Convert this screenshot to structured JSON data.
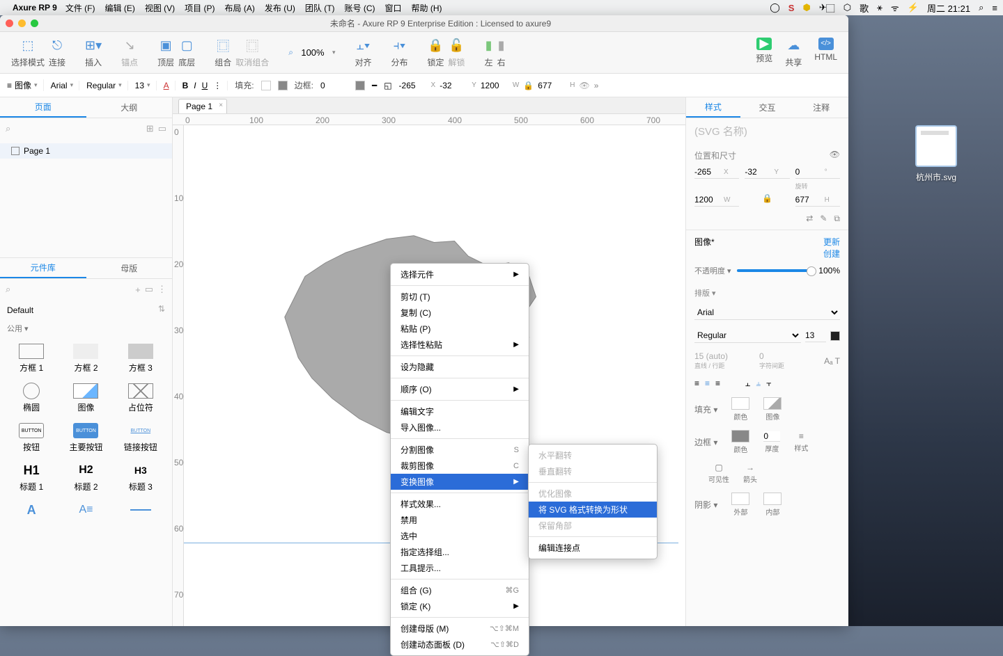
{
  "macmenu": {
    "app": "Axure RP 9",
    "items": [
      "文件 (F)",
      "编辑 (E)",
      "视图 (V)",
      "项目 (P)",
      "布局 (A)",
      "发布 (U)",
      "团队 (T)",
      "账号 (C)",
      "窗口",
      "帮助 (H)"
    ],
    "clock": "周二 21:21"
  },
  "window": {
    "title": "未命名 - Axure RP 9 Enterprise Edition : Licensed to axure9"
  },
  "toolbar": {
    "select_mode": "选择模式",
    "connect": "连接",
    "insert": "插入",
    "point": "锚点",
    "front": "顶层",
    "back": "底层",
    "group": "组合",
    "ungroup": "取消组合",
    "zoom": "100%",
    "align": "对齐",
    "distribute": "分布",
    "lock": "锁定",
    "unlock": "解锁",
    "left": "左",
    "right": "右",
    "preview": "预览",
    "share": "共享",
    "html": "HTML"
  },
  "style_toolbar": {
    "shape": "图像",
    "font": "Arial",
    "weight": "Regular",
    "size": "13",
    "fill": "填充:",
    "border": "边框:",
    "border_w": "0",
    "x": "-265",
    "y": "-32",
    "w": "1200",
    "h": "677"
  },
  "left": {
    "tab_pages": "页面",
    "tab_outline": "大纲",
    "page1": "Page 1",
    "tab_lib": "元件库",
    "tab_master": "母版",
    "lib_default": "Default",
    "lib_common": "公用 ▾",
    "shapes": [
      "方框 1",
      "方框 2",
      "方框 3",
      "椭圆",
      "图像",
      "占位符",
      "按钮",
      "主要按钮",
      "链接按钮",
      "标题 1",
      "标题 2",
      "标题 3"
    ]
  },
  "canvas": {
    "page_tab": "Page 1"
  },
  "ctx": {
    "select_widget": "选择元件",
    "cut": "剪切 (T)",
    "copy": "复制 (C)",
    "paste": "粘贴 (P)",
    "paste_special": "选择性粘贴",
    "set_hidden": "设为隐藏",
    "order": "顺序 (O)",
    "edit_text": "编辑文字",
    "import_image": "导入图像...",
    "slice": "分割图像",
    "sc_slice": "S",
    "crop": "裁剪图像",
    "sc_crop": "C",
    "transform": "变换图像",
    "style_fx": "样式效果...",
    "disabled": "禁用",
    "selected": "选中",
    "select_group": "指定选择组...",
    "tooltip": "工具提示...",
    "group": "组合 (G)",
    "sc_group": "⌘G",
    "lock": "锁定 (K)",
    "create_master": "创建母版 (M)",
    "sc_master": "⌥⇧⌘M",
    "create_dp": "创建动态面板 (D)",
    "sc_dp": "⌥⇧⌘D"
  },
  "sub": {
    "flip_h": "水平翻转",
    "flip_v": "垂直翻转",
    "optimize": "优化图像",
    "svg_to_shape": "将 SVG 格式转换为形状",
    "preserve": "保留角部",
    "edit_conn": "编辑连接点"
  },
  "inspector": {
    "tab_style": "样式",
    "tab_interact": "交互",
    "tab_notes": "注释",
    "svg_name": "(SVG 名称)",
    "pos_size": "位置和尺寸",
    "x": "-265",
    "y": "-32",
    "rot": "0",
    "rot_lbl": "旋转",
    "w": "1200",
    "h": "677",
    "style_name": "图像*",
    "update": "更新",
    "create": "创建",
    "opacity_lbl": "不透明度 ▾",
    "opacity": "100%",
    "layout": "排版 ▾",
    "font": "Arial",
    "weight": "Regular",
    "size": "13",
    "lh": "15 (auto)",
    "lh_lbl": "直线 / 行距",
    "ls": "0",
    "ls_lbl": "字符间距",
    "fill": "填充 ▾",
    "fill_color": "颜色",
    "fill_image": "图像",
    "border": "边框 ▾",
    "border_color": "颜色",
    "border_w": "0",
    "border_w_lbl": "厚度",
    "border_style": "样式",
    "visibility": "可见性",
    "arrow": "箭头",
    "shadow": "阴影 ▾",
    "outer": "外部",
    "inner": "内部"
  },
  "desktop": {
    "filename": "杭州市.svg"
  }
}
